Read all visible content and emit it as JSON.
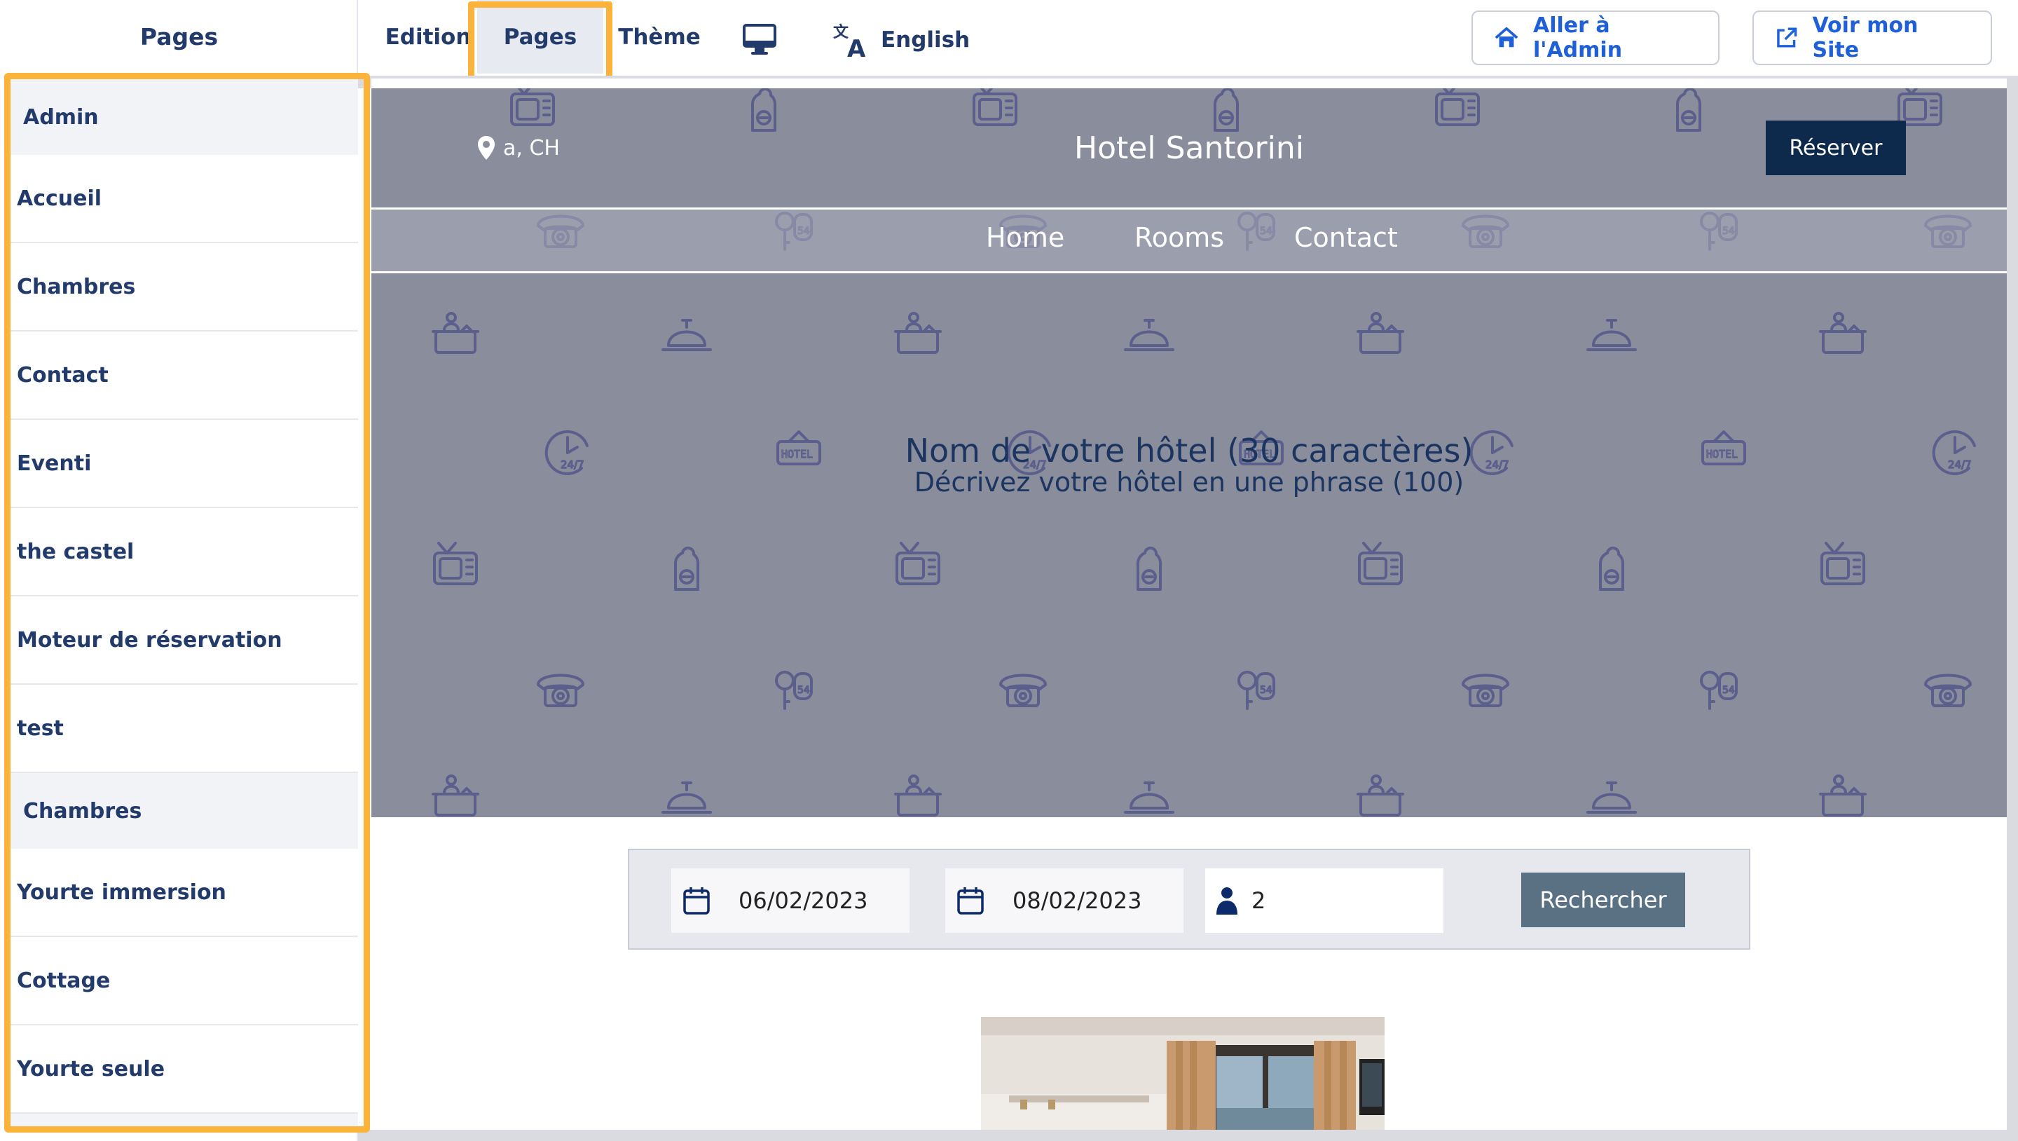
{
  "sidebar": {
    "title": "Pages",
    "sections": [
      {
        "label": "Admin",
        "items": [
          "Accueil",
          "Chambres",
          "Contact",
          "Eventi",
          "the castel",
          "Moteur de réservation",
          "test"
        ]
      },
      {
        "label": "Chambres",
        "items": [
          "Yourte immersion",
          "Cottage",
          "Yourte seule"
        ]
      }
    ]
  },
  "topbar": {
    "tabs": {
      "edition": "Edition",
      "pages": "Pages",
      "theme": "Thème"
    },
    "language": "English",
    "admin_button": "Aller à l'Admin",
    "site_button": "Voir mon Site",
    "monitor_icon": "desktop-monitor-icon",
    "translate_icon": "translate-icon"
  },
  "preview": {
    "location": "a, CH",
    "hotel_name": "Hotel Santorini",
    "reserve_label": "Réserver",
    "nav": {
      "home": "Home",
      "rooms": "Rooms",
      "contact": "Contact"
    },
    "hero_title": "Nom de votre hôtel (30 caractères)",
    "hero_subtitle": "Décrivez votre hôtel en une phrase (100)",
    "search": {
      "checkin": "06/02/2023",
      "checkout": "08/02/2023",
      "guests": "2",
      "button": "Rechercher"
    }
  },
  "colors": {
    "accent_highlight": "#fbb339",
    "brand_text": "#233b6b",
    "link_blue": "#1f5fd8",
    "hero_bg": "#8a8d9c",
    "reserve_bg": "#0d2a4d",
    "search_button": "#5a7184"
  }
}
